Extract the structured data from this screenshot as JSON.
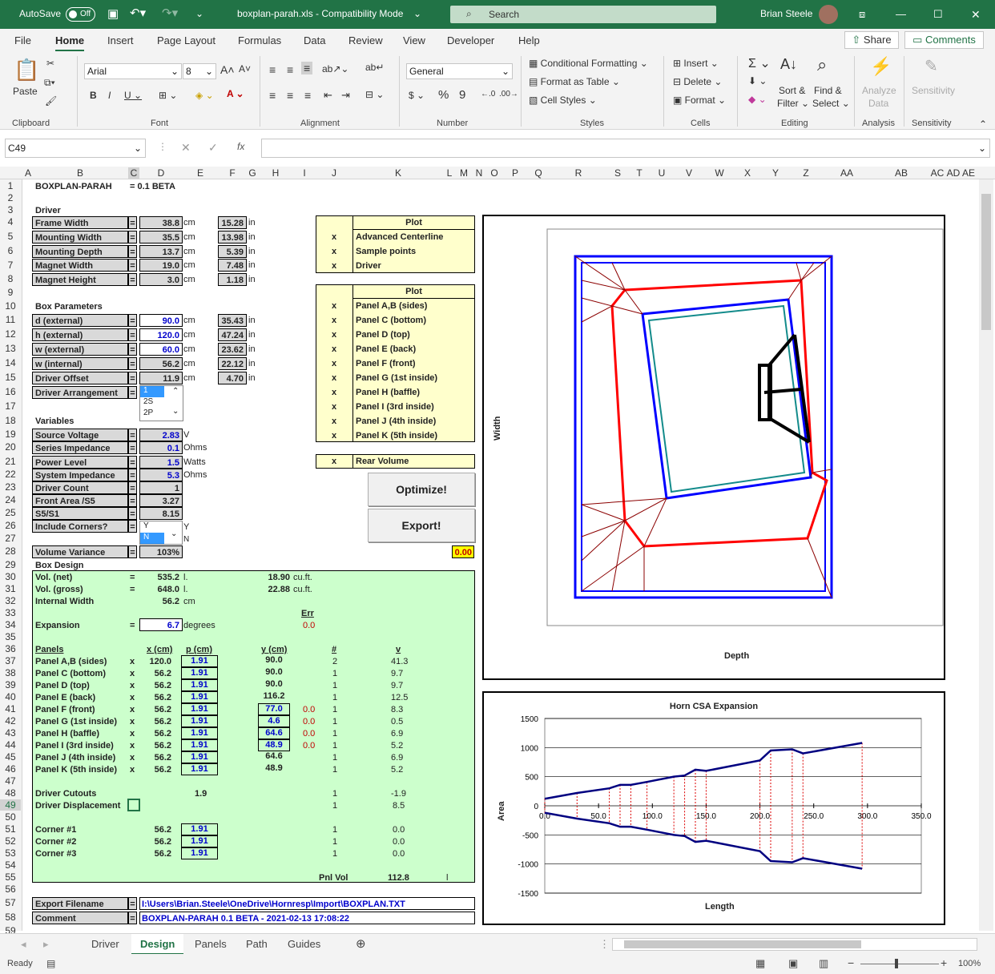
{
  "titlebar": {
    "autosave": "AutoSave",
    "toggle": "Off",
    "filename": "boxplan-parah.xls  -  Compatibility Mode",
    "search": "Search",
    "user": "Brian Steele"
  },
  "menu": [
    "File",
    "Home",
    "Insert",
    "Page Layout",
    "Formulas",
    "Data",
    "Review",
    "View",
    "Developer",
    "Help"
  ],
  "share": "Share",
  "comments": "Comments",
  "ribbon": {
    "paste": "Paste",
    "font_name": "Arial",
    "font_size": "8",
    "number_format": "General",
    "cond_fmt": "Conditional Formatting",
    "fmt_table": "Format as Table",
    "cell_styles": "Cell Styles",
    "insert": "Insert",
    "delete": "Delete",
    "format": "Format",
    "sort": "Sort &",
    "filter": "Filter",
    "find": "Find &",
    "select": "Select",
    "analyze": "Analyze",
    "analyze2": "Data",
    "sensitivity": "Sensitivity",
    "groups": [
      "Clipboard",
      "Font",
      "Alignment",
      "Number",
      "Styles",
      "Cells",
      "Editing",
      "Analysis",
      "Sensitivity"
    ]
  },
  "namebox": "C49",
  "columns": [
    "A",
    "B",
    "C",
    "D",
    "E",
    "F",
    "G",
    "H",
    "I",
    "J",
    "K",
    "L",
    "M",
    "N",
    "O",
    "P",
    "Q",
    "R",
    "S",
    "T",
    "U",
    "V",
    "W",
    "X",
    "Y",
    "Z",
    "AA",
    "AB",
    "AC",
    "AD",
    "AE"
  ],
  "sheet": {
    "title": "BOXPLAN-PARAH",
    "version": "=  0.1 BETA",
    "driver_hdr": "Driver",
    "driver": [
      [
        "Frame Width",
        "38.8",
        "cm",
        "15.28",
        "in"
      ],
      [
        "Mounting Width",
        "35.5",
        "cm",
        "13.98",
        "in"
      ],
      [
        "Mounting Depth",
        "13.7",
        "cm",
        "5.39",
        "in"
      ],
      [
        "Magnet Width",
        "19.0",
        "cm",
        "7.48",
        "in"
      ],
      [
        "Magnet Height",
        "3.0",
        "cm",
        "1.18",
        "in"
      ]
    ],
    "box_hdr": "Box Parameters",
    "box": [
      [
        "d (external)",
        "90.0",
        "cm",
        "35.43",
        "in"
      ],
      [
        "h (external)",
        "120.0",
        "cm",
        "47.24",
        "in"
      ],
      [
        "w (external)",
        "60.0",
        "cm",
        "23.62",
        "in"
      ],
      [
        "w (internal)",
        "56.2",
        "cm",
        "22.12",
        "in"
      ],
      [
        "Driver Offset",
        "11.9",
        "cm",
        "4.70",
        "in"
      ]
    ],
    "arrangement_label": "Driver Arrangement",
    "arrangement_opts": [
      "1",
      "2S",
      "2P"
    ],
    "var_hdr": "Variables",
    "vars": [
      [
        "Source Voltage",
        "2.83",
        "V"
      ],
      [
        "Series Impedance",
        "0.1",
        "Ohms"
      ],
      [
        "Power Level",
        "1.5",
        "Watts"
      ],
      [
        "System Impedance",
        "5.3",
        "Ohms"
      ],
      [
        "Driver Count",
        "1",
        ""
      ],
      [
        "Front Area /S5",
        "3.27",
        ""
      ],
      [
        "S5/S1",
        "8.15",
        ""
      ]
    ],
    "corners_label": "Include Corners?",
    "corners_opts": [
      "Y",
      "N"
    ],
    "corners_val": "Y",
    "corners_n": "N",
    "volvar_label": "Volume Variance",
    "volvar": "103%",
    "design_hdr": "Box Design",
    "vol_net": "Vol. (net)",
    "vol_net_v": "535.2",
    "vol_net_u": "l.",
    "vol_net_cf": "18.90",
    "cuft": "cu.ft.",
    "vol_gross": "Vol. (gross)",
    "vol_gross_v": "648.0",
    "vol_gross_u": "l.",
    "vol_gross_cf": "22.88",
    "int_width": "Internal Width",
    "int_width_v": "56.2",
    "cm": "cm",
    "err_hdr": "Err",
    "expansion": "Expansion",
    "expansion_v": "6.7",
    "degrees": "degrees",
    "err_v": "0.0",
    "panel_hdrs": [
      "Panels",
      "x (cm)",
      "p (cm)",
      "y (cm)",
      "#",
      "v"
    ],
    "panels": [
      [
        "Panel A,B (sides)",
        "120.0",
        "1.91",
        "90.0",
        "",
        "2",
        "41.3"
      ],
      [
        "Panel C (bottom)",
        "56.2",
        "1.91",
        "90.0",
        "",
        "1",
        "9.7"
      ],
      [
        "Panel D (top)",
        "56.2",
        "1.91",
        "90.0",
        "",
        "1",
        "9.7"
      ],
      [
        "Panel E (back)",
        "56.2",
        "1.91",
        "116.2",
        "",
        "1",
        "12.5"
      ],
      [
        "Panel F (front)",
        "56.2",
        "1.91",
        "77.0",
        "0.0",
        "1",
        "8.3"
      ],
      [
        "Panel G (1st inside)",
        "56.2",
        "1.91",
        "4.6",
        "0.0",
        "1",
        "0.5"
      ],
      [
        "Panel H (baffle)",
        "56.2",
        "1.91",
        "64.6",
        "0.0",
        "1",
        "6.9"
      ],
      [
        "Panel I (3rd inside)",
        "56.2",
        "1.91",
        "48.9",
        "0.0",
        "1",
        "5.2"
      ],
      [
        "Panel J (4th inside)",
        "56.2",
        "1.91",
        "64.6",
        "",
        "1",
        "6.9"
      ],
      [
        "Panel K (5th inside)",
        "56.2",
        "1.91",
        "48.9",
        "",
        "1",
        "5.2"
      ]
    ],
    "cutouts": "Driver Cutouts",
    "cutouts_v": "1.9",
    "cutouts_n": "1",
    "cutouts_val": "-1.9",
    "displacement": "Driver Displacement",
    "disp_n": "1",
    "disp_val": "8.5",
    "corners": [
      [
        "Corner #1",
        "56.2",
        "1.91",
        "1",
        "0.0"
      ],
      [
        "Corner #2",
        "56.2",
        "1.91",
        "1",
        "0.0"
      ],
      [
        "Corner #3",
        "56.2",
        "1.91",
        "1",
        "0.0"
      ]
    ],
    "pnlvol": "Pnl Vol",
    "pnlvol_v": "112.8",
    "pnlvol_u": "l",
    "export_label": "Export Filename",
    "export_v": "I:\\Users\\Brian.Steele\\OneDrive\\Hornresp\\Import\\BOXPLAN.TXT",
    "comment_label": "Comment",
    "comment_v": "BOXPLAN-PARAH 0.1 BETA - 2021-02-13 17:08:22",
    "plot1_hdr": "Plot",
    "plot1": [
      "Advanced Centerline",
      "Sample points",
      "Driver"
    ],
    "plot2_hdr": "Plot",
    "plot2": [
      "Panel A,B (sides)",
      "Panel C (bottom)",
      "Panel D (top)",
      "Panel E (back)",
      "Panel F (front)",
      "Panel G (1st inside)",
      "Panel H (baffle)",
      "Panel I (3rd inside)",
      "Panel J (4th inside)",
      "Panel K (5th inside)"
    ],
    "rear_volume": "Rear Volume",
    "x": "x",
    "optimize": "Optimize!",
    "export": "Export!",
    "yellow_val": "0.00"
  },
  "chart1": {
    "xlabel": "Depth",
    "ylabel": "Width"
  },
  "chart_data": {
    "type": "line",
    "title": "Horn CSA Expansion",
    "xlabel": "Length",
    "ylabel": "Area",
    "xlim": [
      0,
      350
    ],
    "ylim": [
      -1500,
      1500
    ],
    "xticks": [
      "0.0",
      "50.0",
      "100.0",
      "150.0",
      "200.0",
      "250.0",
      "300.0",
      "350.0"
    ],
    "yticks": [
      "1500",
      "1000",
      "500",
      "0",
      "-500",
      "-1000",
      "-1500"
    ],
    "series": [
      {
        "values": [
          [
            0,
            120
          ],
          [
            30,
            220
          ],
          [
            60,
            300
          ],
          [
            70,
            360
          ],
          [
            80,
            360
          ],
          [
            95,
            410
          ],
          [
            120,
            500
          ],
          [
            130,
            520
          ],
          [
            140,
            620
          ],
          [
            150,
            600
          ],
          [
            200,
            780
          ],
          [
            210,
            950
          ],
          [
            230,
            970
          ],
          [
            240,
            900
          ],
          [
            295,
            1080
          ]
        ]
      }
    ]
  },
  "tabs": [
    "Driver",
    "Design",
    "Panels",
    "Path",
    "Guides"
  ],
  "status": {
    "ready": "Ready",
    "zoom": "100%"
  }
}
